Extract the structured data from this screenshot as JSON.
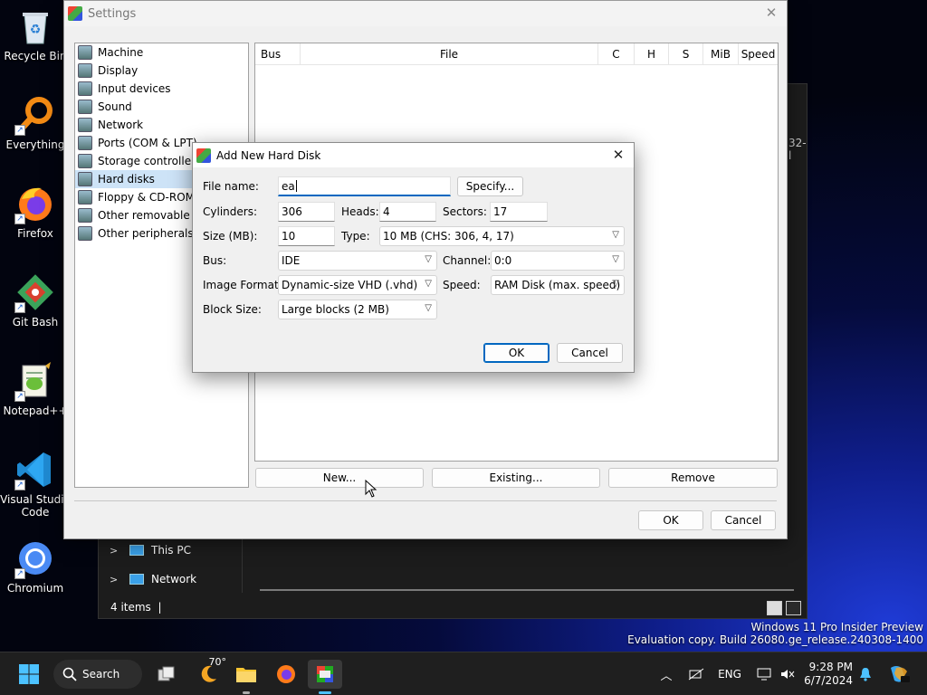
{
  "desktop": {
    "icons": [
      {
        "label": "Recycle Bin",
        "icon": "recycle-bin-icon"
      },
      {
        "label": "Everything",
        "icon": "everything-icon"
      },
      {
        "label": "Firefox",
        "icon": "firefox-icon"
      },
      {
        "label": "Git Bash",
        "icon": "git-bash-icon"
      },
      {
        "label": "Notepad++",
        "icon": "notepadpp-icon"
      },
      {
        "label": "Visual Studio Code",
        "icon": "vscode-icon"
      },
      {
        "label": "Chromium",
        "icon": "chromium-icon"
      }
    ]
  },
  "explorer": {
    "nav": [
      {
        "label": "This PC"
      },
      {
        "label": "Network"
      }
    ],
    "status": "4 items",
    "partial_text": "32-l"
  },
  "settings": {
    "title": "Settings",
    "tree": [
      {
        "label": "Machine",
        "selected": false
      },
      {
        "label": "Display",
        "selected": false
      },
      {
        "label": "Input devices",
        "selected": false
      },
      {
        "label": "Sound",
        "selected": false
      },
      {
        "label": "Network",
        "selected": false
      },
      {
        "label": "Ports (COM & LPT)",
        "selected": false
      },
      {
        "label": "Storage controllers",
        "selected": false
      },
      {
        "label": "Hard disks",
        "selected": true
      },
      {
        "label": "Floppy & CD-ROM d",
        "selected": false
      },
      {
        "label": "Other removable de",
        "selected": false
      },
      {
        "label": "Other peripherals",
        "selected": false
      }
    ],
    "columns": [
      "Bus",
      "File",
      "C",
      "H",
      "S",
      "MiB",
      "Speed"
    ],
    "buttons": {
      "new": "New...",
      "existing": "Existing...",
      "remove": "Remove",
      "ok": "OK",
      "cancel": "Cancel"
    }
  },
  "dialog": {
    "title": "Add New Hard Disk",
    "labels": {
      "file_name": "File name:",
      "cylinders": "Cylinders:",
      "heads": "Heads:",
      "sectors": "Sectors:",
      "size": "Size (MB):",
      "type": "Type:",
      "bus": "Bus:",
      "channel": "Channel:",
      "image_format": "Image Format:",
      "speed": "Speed:",
      "block_size": "Block Size:"
    },
    "values": {
      "file_name": "ea",
      "cylinders": "306",
      "heads": "4",
      "sectors": "17",
      "size": "10",
      "type": "10 MB (CHS: 306, 4, 17)",
      "bus": "IDE",
      "channel": "0:0",
      "image_format": "Dynamic-size VHD (.vhd)",
      "speed": "RAM Disk (max. speed)",
      "block_size": "Large blocks (2 MB)"
    },
    "buttons": {
      "specify": "Specify...",
      "ok": "OK",
      "cancel": "Cancel"
    }
  },
  "taskbar": {
    "search_label": "Search",
    "weather": "70°",
    "language": "ENG",
    "time": "9:28 PM",
    "date": "6/7/2024"
  },
  "watermark": {
    "line1": "Windows 11 Pro Insider Preview",
    "line2": "Evaluation copy. Build 26080.ge_release.240308-1400"
  }
}
